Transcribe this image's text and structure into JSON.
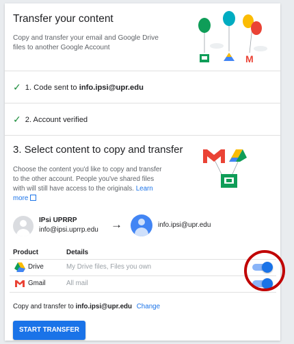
{
  "header": {
    "title": "Transfer your content",
    "subtitle": "Copy and transfer your email and Google Drive files to another Google Account"
  },
  "steps": [
    {
      "prefix": "1. Code sent to ",
      "email": "info.ipsi@upr.edu"
    },
    {
      "prefix": "2. Account verified"
    }
  ],
  "select": {
    "title": "3. Select content to copy and transfer",
    "description": "Choose the content you'd like to copy and transfer to the other account. People you've shared files with will still have access to the originals.",
    "learn_more": "Learn more"
  },
  "accounts": {
    "source_name": "IPsi UPRRP",
    "source_email": "info@ipsi.uprrp.edu",
    "arrow": "→",
    "destination_email": "info.ipsi@upr.edu"
  },
  "table": {
    "headers": {
      "product": "Product",
      "details": "Details"
    },
    "rows": [
      {
        "product": "Drive",
        "details": "My Drive files, Files you own",
        "enabled": true,
        "icon": "drive-icon"
      },
      {
        "product": "Gmail",
        "details": "All mail",
        "enabled": true,
        "icon": "gmail-icon"
      }
    ]
  },
  "footer": {
    "copy_prefix": "Copy and transfer to ",
    "copy_email": "info.ipsi@upr.edu",
    "change_label": "Change",
    "start_label": "START TRANSFER"
  },
  "colors": {
    "accent": "#1a73e8",
    "check": "#1e8e3e",
    "highlight_circle": "#c00000"
  }
}
